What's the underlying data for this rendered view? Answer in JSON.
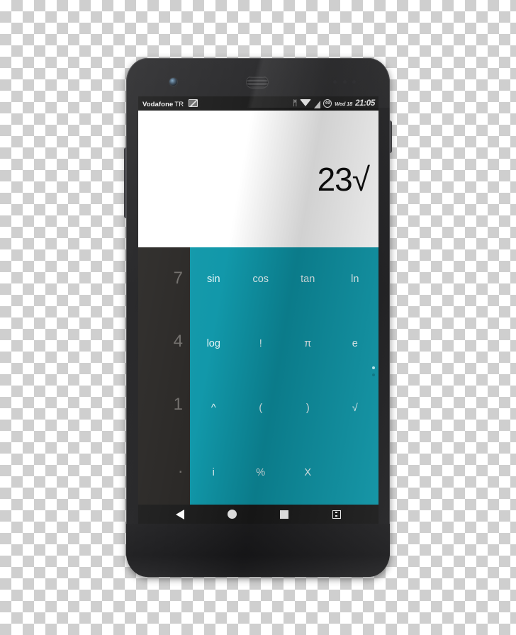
{
  "device": {
    "name": "android-smartphone",
    "hardware": {
      "camera_icon": "front-camera",
      "earpiece_icon": "earpiece-speaker",
      "sensor_icon": "proximity-sensor",
      "power_button": "power-button",
      "volume_button": "volume-rocker"
    }
  },
  "statusbar": {
    "carrier": "Vodafone",
    "carrier_region": "TR",
    "screenshot_icon": "screenshot-icon",
    "bluetooth_icon": "bluetooth-icon",
    "bluetooth_glyph": "ᛗ",
    "wifi_icon": "wifi-icon",
    "signal_icon": "cellular-signal-icon",
    "battery_icon": "battery-circle-icon",
    "battery_level": "49",
    "date": "Wed 18",
    "time": "21:05"
  },
  "app": {
    "name": "calculator",
    "display": {
      "expression": "23√"
    },
    "numpad": {
      "keys": [
        "7",
        "4",
        "1",
        "."
      ]
    },
    "functionpad": {
      "rows": [
        [
          "sin",
          "cos",
          "tan",
          "ln"
        ],
        [
          "log",
          "!",
          "π",
          "e"
        ],
        [
          "^",
          "(",
          ")",
          "√"
        ],
        [
          "i",
          "%",
          "X",
          ""
        ]
      ]
    },
    "pager": {
      "active_dot": "page-1",
      "inactive_dot": "page-2"
    },
    "colors": {
      "accent_teal": "#0d96a8",
      "numpad_dark": "#272523",
      "display_bg": "#ffffff",
      "system_bar": "#1b1b1b"
    }
  },
  "navbar": {
    "back_icon": "back-triangle-icon",
    "home_icon": "home-circle-icon",
    "recents_icon": "recents-square-icon",
    "extra_icon": "menu-square-icon"
  }
}
